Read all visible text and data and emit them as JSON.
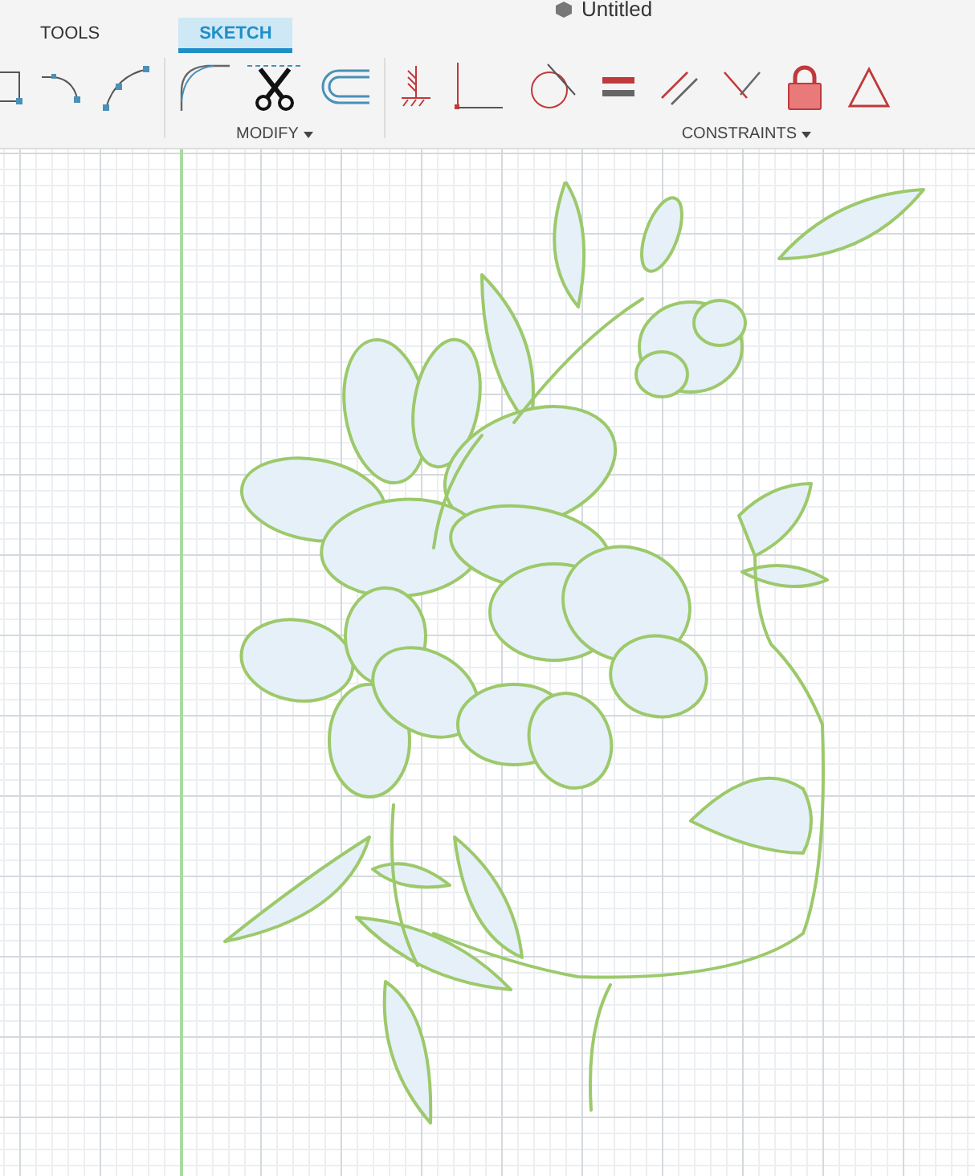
{
  "window": {
    "title": "Untitled"
  },
  "tabs": [
    {
      "label": "TOOLS",
      "selected": false
    },
    {
      "label": "SKETCH",
      "selected": true
    }
  ],
  "toolbar_groups": [
    {
      "label": "MODIFY",
      "has_menu": true
    },
    {
      "label": "CONSTRAINTS",
      "has_menu": true
    }
  ]
}
